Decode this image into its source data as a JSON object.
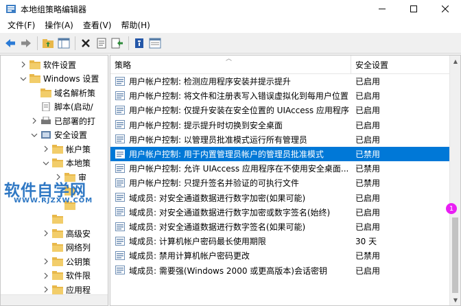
{
  "window": {
    "title": "本地组策略编辑器"
  },
  "menu": [
    "文件(F)",
    "操作(A)",
    "查看(V)",
    "帮助(H)"
  ],
  "tree": [
    {
      "label": "软件设置",
      "level": 2,
      "chev": "right"
    },
    {
      "label": "Windows 设置",
      "level": 2,
      "chev": "down"
    },
    {
      "label": "域名解析策",
      "level": 3,
      "chev": "none"
    },
    {
      "label": "脚本(启动/",
      "level": 3,
      "chev": "none"
    },
    {
      "label": "已部署的打",
      "level": 3,
      "chev": "right"
    },
    {
      "label": "安全设置",
      "level": 3,
      "chev": "down"
    },
    {
      "label": "帐户策",
      "level": 4,
      "chev": "right"
    },
    {
      "label": "本地策",
      "level": 4,
      "chev": "down"
    },
    {
      "label": "审",
      "level": 5,
      "chev": "right"
    },
    {
      "label": "",
      "level": 5,
      "chev": "none"
    },
    {
      "label": "",
      "level": 5,
      "chev": "none"
    },
    {
      "label": "",
      "level": 4,
      "chev": "none"
    },
    {
      "label": "高级安",
      "level": 4,
      "chev": "right"
    },
    {
      "label": "网络列",
      "level": 4,
      "chev": "none"
    },
    {
      "label": "公钥策",
      "level": 4,
      "chev": "right"
    },
    {
      "label": "软件限",
      "level": 4,
      "chev": "right"
    },
    {
      "label": "应用程",
      "level": 4,
      "chev": "right"
    }
  ],
  "columns": {
    "policy": "策略",
    "setting": "安全设置"
  },
  "rows": [
    {
      "policy": "用户帐户控制: 检测应用程序安装并提示提升",
      "setting": "已启用"
    },
    {
      "policy": "用户帐户控制: 将文件和注册表写入错误虚拟化到每用户位置",
      "setting": "已启用"
    },
    {
      "policy": "用户帐户控制: 仅提升安装在安全位置的 UIAccess 应用程序",
      "setting": "已启用"
    },
    {
      "policy": "用户帐户控制: 提示提升时切换到安全桌面",
      "setting": "已启用"
    },
    {
      "policy": "用户帐户控制: 以管理员批准模式运行所有管理员",
      "setting": "已启用"
    },
    {
      "policy": "用户帐户控制: 用于内置管理员帐户的管理员批准模式",
      "setting": "已禁用",
      "selected": true
    },
    {
      "policy": "用户帐户控制: 允许 UIAccess 应用程序在不使用安全桌面...",
      "setting": "已禁用"
    },
    {
      "policy": "用户帐户控制: 只提升签名并验证的可执行文件",
      "setting": "已禁用"
    },
    {
      "policy": "域成员: 对安全通道数据进行数字加密(如果可能)",
      "setting": "已启用"
    },
    {
      "policy": "域成员: 对安全通道数据进行数字加密或数字签名(始终)",
      "setting": "已启用"
    },
    {
      "policy": "域成员: 对安全通道数据进行数字签名(如果可能)",
      "setting": "已启用"
    },
    {
      "policy": "域成员: 计算机帐户密码最长使用期限",
      "setting": "30 天"
    },
    {
      "policy": "域成员: 禁用计算机帐户密码更改",
      "setting": "已禁用"
    },
    {
      "policy": "域成员: 需要强(Windows 2000 或更高版本)会话密钥",
      "setting": "已启用"
    }
  ],
  "badge": "1",
  "watermark": {
    "title": "软件自学网",
    "url": "WWW.RJZXW.COM"
  },
  "colors": {
    "selection": "#0078d7",
    "folder": "#e8b84a",
    "badge": "#e91ef4",
    "watermark": "#2f78c4"
  }
}
